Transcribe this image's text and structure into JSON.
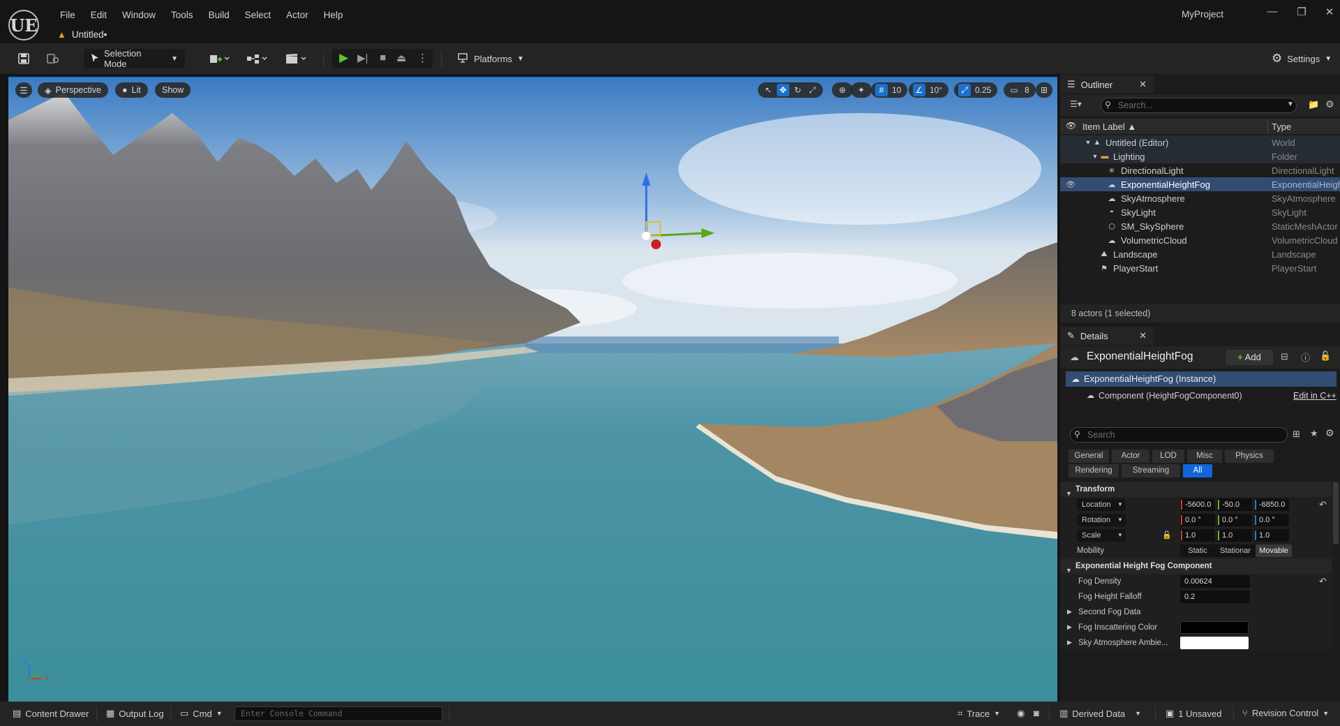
{
  "app": {
    "logo": "UE",
    "menus": [
      "File",
      "Edit",
      "Window",
      "Tools",
      "Build",
      "Select",
      "Actor",
      "Help"
    ],
    "document_tab": "Untitled•",
    "project_name": "MyProject",
    "window_controls": {
      "minimize": "—",
      "restore": "❐",
      "close": "✕"
    }
  },
  "toolbar": {
    "selection_mode": "Selection Mode",
    "platforms": "Platforms",
    "settings": "Settings"
  },
  "viewport": {
    "menu_icon": "hamburger-icon",
    "perspective": "Perspective",
    "lit": "Lit",
    "show": "Show",
    "grid_snap": "10",
    "rotation_snap": "10°",
    "scale_snap": "0.25",
    "camera_speed": "8",
    "axis_labels": {
      "z": "Z",
      "x": "X",
      "y": "Y"
    }
  },
  "outliner": {
    "tab_label": "Outliner",
    "search_placeholder": "Search...",
    "col_label": "Item Label ▲",
    "col_type": "Type",
    "rows": [
      {
        "name": "Untitled (Editor)",
        "type": "World",
        "icon": "world-icon"
      },
      {
        "name": "Lighting",
        "type": "Folder",
        "icon": "folder-icon"
      },
      {
        "name": "DirectionalLight",
        "type": "DirectionalLight",
        "icon": "sun-icon"
      },
      {
        "name": "ExponentialHeightFog",
        "type": "ExponentialHeigh",
        "icon": "fog-icon"
      },
      {
        "name": "SkyAtmosphere",
        "type": "SkyAtmosphere",
        "icon": "cloud-icon"
      },
      {
        "name": "SkyLight",
        "type": "SkyLight",
        "icon": "skylight-icon"
      },
      {
        "name": "SM_SkySphere",
        "type": "StaticMeshActor",
        "icon": "mesh-icon"
      },
      {
        "name": "VolumetricCloud",
        "type": "VolumetricCloud",
        "icon": "cloud-icon"
      },
      {
        "name": "Landscape",
        "type": "Landscape",
        "icon": "landscape-icon"
      },
      {
        "name": "PlayerStart",
        "type": "PlayerStart",
        "icon": "flag-icon"
      }
    ],
    "footer": "8 actors (1 selected)"
  },
  "details": {
    "tab_label": "Details",
    "actor_name": "ExponentialHeightFog",
    "add_label": "Add",
    "instance_label": "ExponentialHeightFog (Instance)",
    "component_label": "Component (HeightFogComponent0)",
    "edit_cpp": "Edit in C++",
    "search_placeholder": "Search",
    "filters": [
      "General",
      "Actor",
      "LOD",
      "Misc",
      "Physics",
      "Rendering",
      "Streaming",
      "All"
    ],
    "transform": {
      "section": "Transform",
      "location_label": "Location",
      "location": [
        "-5600.0",
        "-50.0",
        "-6850.0"
      ],
      "rotation_label": "Rotation",
      "rotation": [
        "0.0 °",
        "0.0 °",
        "0.0 °"
      ],
      "scale_label": "Scale",
      "scale": [
        "1.0",
        "1.0",
        "1.0"
      ],
      "mobility_label": "Mobility",
      "mobility_options": [
        "Static",
        "Stationar",
        "Movable"
      ],
      "mobility_selected": "Movable"
    },
    "fog": {
      "section": "Exponential Height Fog Component",
      "density_label": "Fog Density",
      "density": "0.00624",
      "falloff_label": "Fog Height Falloff",
      "falloff": "0.2",
      "second_fog": "Second Fog Data",
      "inscatter_label": "Fog Inscattering Color",
      "inscatter_color": "#000000",
      "sky_ambient_label": "Sky Atmosphere Ambie...",
      "sky_ambient_color": "#ffffff"
    }
  },
  "statusbar": {
    "content_drawer": "Content Drawer",
    "output_log": "Output Log",
    "cmd": "Cmd",
    "console_placeholder": "Enter Console Command",
    "trace": "Trace",
    "derived_data": "Derived Data",
    "unsaved": "1 Unsaved",
    "revision_control": "Revision Control"
  }
}
